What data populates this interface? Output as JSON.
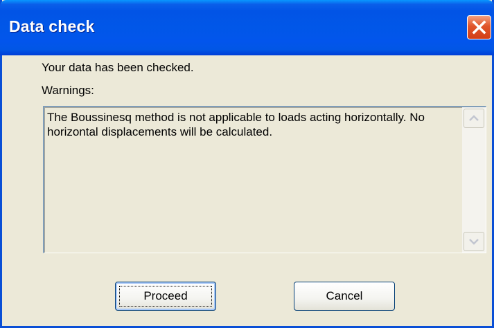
{
  "dialog": {
    "title": "Data check",
    "close_icon": "close-icon",
    "message": "Your data has been checked.",
    "warnings_label": "Warnings:",
    "warning_text": "The Boussinesq method is not applicable to loads acting horizontally. No horizontal displacements will be calculated.",
    "buttons": {
      "proceed": "Proceed",
      "cancel": "Cancel"
    },
    "colors": {
      "titlebar": "#0254e6",
      "close_button": "#e0542a",
      "background": "#ece9d8"
    }
  }
}
